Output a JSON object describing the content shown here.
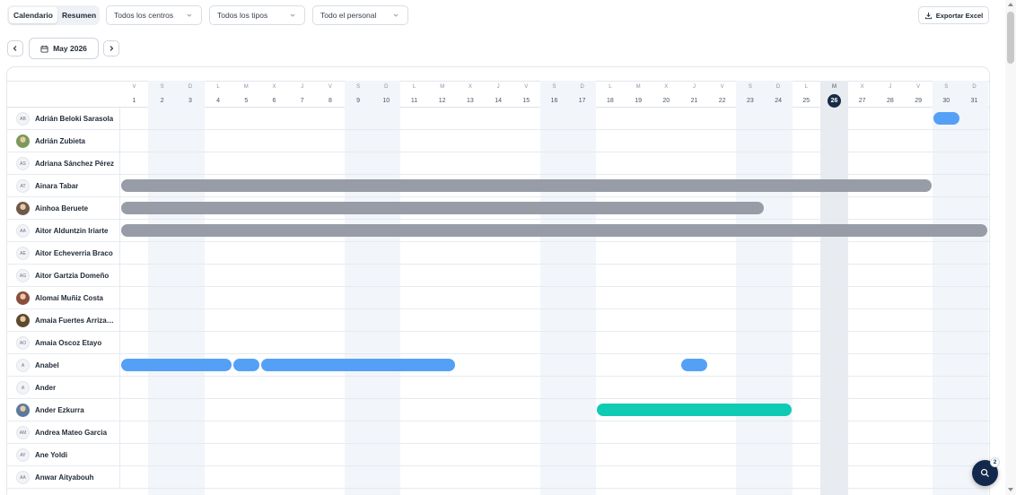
{
  "toolbar": {
    "view_tabs": [
      "Calendario",
      "Resumen"
    ],
    "active_view": "Calendario",
    "filters": {
      "centers": "Todos los centros",
      "types": "Todos los tipos",
      "staff": "Todo el personal"
    },
    "export_label": "Exportar Excel"
  },
  "navigation": {
    "month_label": "May 2026"
  },
  "calendar": {
    "today": 26,
    "days": [
      {
        "d": "V",
        "n": 1
      },
      {
        "d": "S",
        "n": 2
      },
      {
        "d": "D",
        "n": 3
      },
      {
        "d": "L",
        "n": 4
      },
      {
        "d": "M",
        "n": 5
      },
      {
        "d": "X",
        "n": 6
      },
      {
        "d": "J",
        "n": 7
      },
      {
        "d": "V",
        "n": 8
      },
      {
        "d": "S",
        "n": 9
      },
      {
        "d": "D",
        "n": 10
      },
      {
        "d": "L",
        "n": 11
      },
      {
        "d": "M",
        "n": 12
      },
      {
        "d": "X",
        "n": 13
      },
      {
        "d": "J",
        "n": 14
      },
      {
        "d": "V",
        "n": 15
      },
      {
        "d": "S",
        "n": 16
      },
      {
        "d": "D",
        "n": 17
      },
      {
        "d": "L",
        "n": 18
      },
      {
        "d": "M",
        "n": 19
      },
      {
        "d": "X",
        "n": 20
      },
      {
        "d": "J",
        "n": 21
      },
      {
        "d": "V",
        "n": 22
      },
      {
        "d": "S",
        "n": 23
      },
      {
        "d": "D",
        "n": 24
      },
      {
        "d": "L",
        "n": 25
      },
      {
        "d": "M",
        "n": 26
      },
      {
        "d": "X",
        "n": 27
      },
      {
        "d": "J",
        "n": 28
      },
      {
        "d": "V",
        "n": 29
      },
      {
        "d": "S",
        "n": 30
      },
      {
        "d": "D",
        "n": 31
      }
    ],
    "colors": {
      "gray": "#979ca7",
      "blue": "#55a0f7",
      "teal": "#0fcbb3"
    },
    "employees": [
      {
        "name": "Adrián Beloki Sarasola",
        "initials": "AB",
        "photo": null,
        "bars": [
          {
            "start": 30,
            "end": 30,
            "color": "blue"
          }
        ]
      },
      {
        "name": "Adrián Zubieta",
        "initials": "",
        "photo": "#7a9a5a",
        "bars": []
      },
      {
        "name": "Adriana Sánchez Pérez",
        "initials": "AS",
        "photo": null,
        "bars": []
      },
      {
        "name": "Ainara Tabar",
        "initials": "AT",
        "photo": null,
        "bars": [
          {
            "start": 1,
            "end": 29,
            "color": "gray"
          }
        ]
      },
      {
        "name": "Ainhoa Beruete",
        "initials": "",
        "photo": "#6f5a4a",
        "bars": [
          {
            "start": 1,
            "end": 23,
            "color": "gray"
          }
        ]
      },
      {
        "name": "Aitor Alduntzin Iriarte",
        "initials": "AA",
        "photo": null,
        "bars": [
          {
            "start": 1,
            "end": 31,
            "color": "gray"
          }
        ]
      },
      {
        "name": "Aitor Echeverria Braco",
        "initials": "AE",
        "photo": null,
        "bars": []
      },
      {
        "name": "Aitor Gartzia Domeño",
        "initials": "AG",
        "photo": null,
        "bars": []
      },
      {
        "name": "Alomaí Muñiz Costa",
        "initials": "",
        "photo": "#8a4e3c",
        "bars": []
      },
      {
        "name": "Amaia Fuertes Arrizabalaga",
        "initials": "",
        "photo": "#5c4a2e",
        "bars": []
      },
      {
        "name": "Amaia Oscoz Etayo",
        "initials": "AO",
        "photo": null,
        "bars": []
      },
      {
        "name": "Anabel",
        "initials": "A",
        "photo": null,
        "bars": [
          {
            "start": 1,
            "end": 4,
            "color": "blue"
          },
          {
            "start": 5,
            "end": 5,
            "color": "blue"
          },
          {
            "start": 6,
            "end": 12,
            "color": "blue"
          },
          {
            "start": 21,
            "end": 21,
            "color": "blue"
          }
        ]
      },
      {
        "name": "Ander",
        "initials": "A",
        "photo": null,
        "bars": []
      },
      {
        "name": "Ander Ezkurra",
        "initials": "",
        "photo": "#5d7a9c",
        "bars": [
          {
            "start": 18,
            "end": 24,
            "color": "teal"
          }
        ]
      },
      {
        "name": "Andrea Mateo Garcia",
        "initials": "AM",
        "photo": null,
        "bars": []
      },
      {
        "name": "Ane Yoldi",
        "initials": "AY",
        "photo": null,
        "bars": []
      },
      {
        "name": "Anwar Aityabouh",
        "initials": "AA",
        "photo": null,
        "bars": []
      }
    ]
  },
  "fab": {
    "badge": "2"
  }
}
